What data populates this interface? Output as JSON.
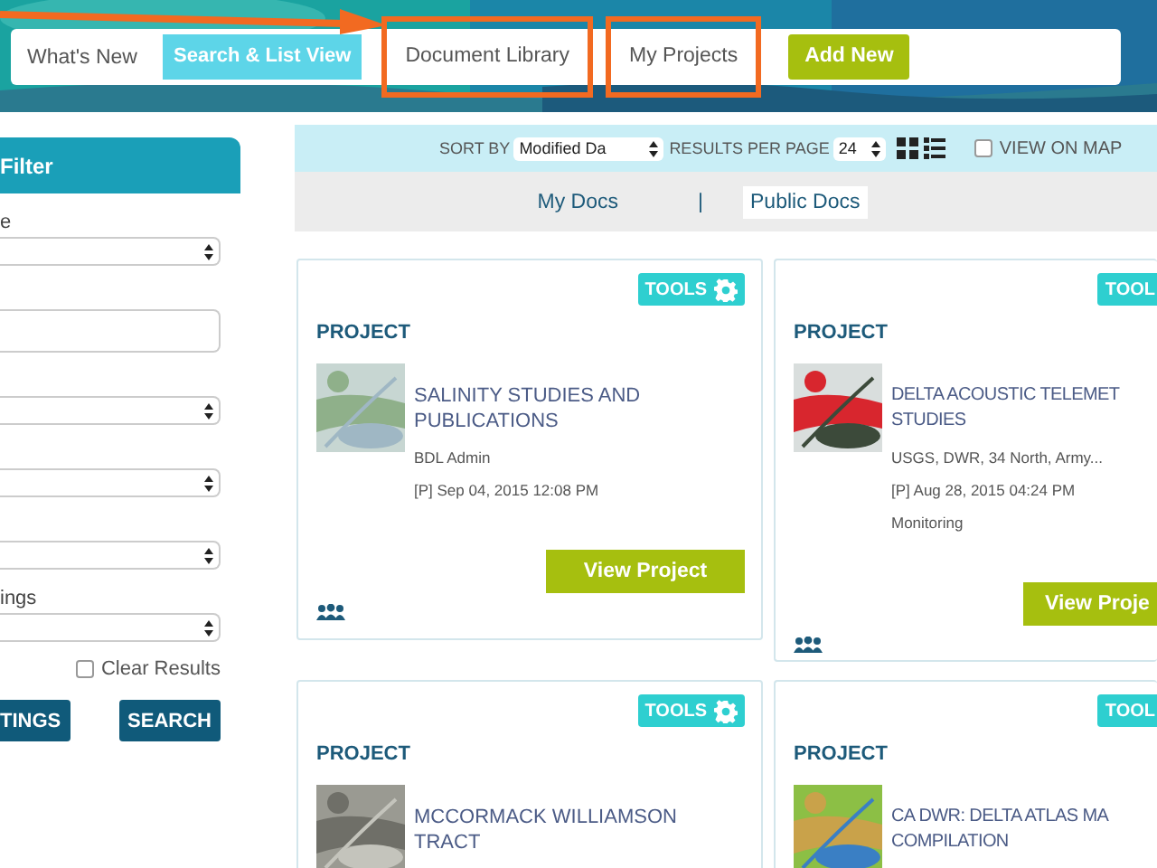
{
  "nav": [
    {
      "label": "What's New",
      "kind": "link",
      "highlighted": false
    },
    {
      "label": "Search & List View",
      "kind": "active",
      "highlighted": false
    },
    {
      "label": "Document Library",
      "kind": "link",
      "highlighted": true
    },
    {
      "label": "My Projects",
      "kind": "link",
      "highlighted": true
    },
    {
      "label": "Add New",
      "kind": "add",
      "highlighted": false
    }
  ],
  "filter": {
    "title": "Filter",
    "fields": [
      {
        "label": "e",
        "kind": "select"
      },
      {
        "kind": "input"
      },
      {
        "kind": "select"
      },
      {
        "kind": "select"
      },
      {
        "kind": "select"
      },
      {
        "label": "ings",
        "kind": "select"
      }
    ],
    "clear": {
      "label": "Clear Results",
      "checked": false
    },
    "buttons": [
      "TINGS",
      "SEARCH"
    ]
  },
  "toolbar": {
    "sort_label": "SORT BY",
    "sort_value": "Modified Da",
    "per_page_label": "RESULTS PER PAGE",
    "per_page_value": "24",
    "map": {
      "label": "VIEW ON MAP",
      "checked": false
    }
  },
  "doc_tabs": [
    {
      "label": "My Docs",
      "selected": false
    },
    {
      "label": "|",
      "kind": "separator"
    },
    {
      "label": "Public Docs",
      "selected": true
    }
  ],
  "cards": [
    {
      "tools": "TOOLS",
      "type": "PROJECT",
      "title_lines": [
        "SALINITY STUDIES AND",
        "PUBLICATIONS"
      ],
      "meta": [
        "BDL Admin",
        "[P] Sep 04, 2015 12:08 PM"
      ],
      "button": "View Project"
    },
    {
      "tools": "TOOL",
      "type": "PROJECT",
      "title_lines": [
        "DELTA ACOUSTIC TELEMET",
        "STUDIES"
      ],
      "meta": [
        "USGS, DWR, 34 North, Army...",
        "[P] Aug 28, 2015 04:24 PM",
        "Monitoring"
      ],
      "button": "View Proje"
    },
    {
      "tools": "TOOLS",
      "type": "PROJECT",
      "title_lines": [
        "MCCORMACK WILLIAMSON",
        "TRACT"
      ]
    },
    {
      "tools": "TOOL",
      "type": "PROJECT",
      "title_lines": [
        "CA DWR: DELTA ATLAS MA",
        "COMPILATION"
      ]
    }
  ]
}
